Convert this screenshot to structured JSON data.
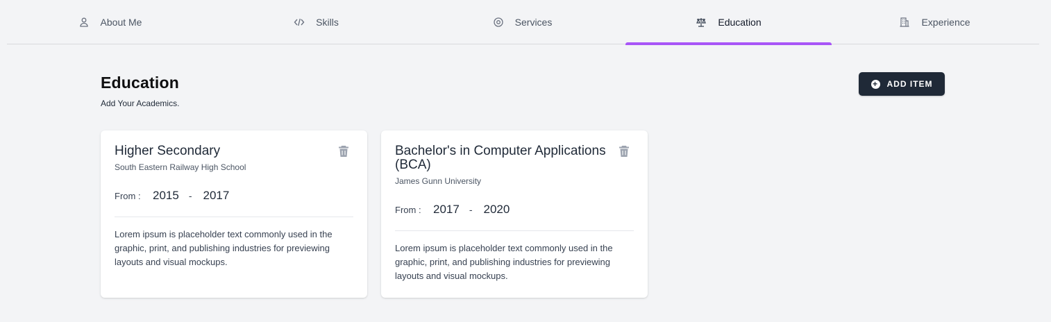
{
  "tabs": [
    {
      "label": "About Me",
      "icon": "user-icon"
    },
    {
      "label": "Skills",
      "icon": "code-icon"
    },
    {
      "label": "Services",
      "icon": "target-icon"
    },
    {
      "label": "Education",
      "icon": "scale-icon",
      "active": true
    },
    {
      "label": "Experience",
      "icon": "building-icon"
    }
  ],
  "accent_color": "#a855f7",
  "header": {
    "title": "Education",
    "subtitle": "Add Your Academics.",
    "add_button_label": "ADD ITEM"
  },
  "cards": [
    {
      "title": "Higher Secondary",
      "school": "South Eastern Railway High School",
      "from_label": "From :",
      "start_year": "2015",
      "separator": "-",
      "end_year": "2017",
      "description": "Lorem ipsum is placeholder text commonly used in the graphic, print, and publishing industries for previewing layouts and visual mockups."
    },
    {
      "title": "Bachelor's in Computer Applications (BCA)",
      "school": "James Gunn University",
      "from_label": "From :",
      "start_year": "2017",
      "separator": "-",
      "end_year": "2020",
      "description": "Lorem ipsum is placeholder text commonly used in the graphic, print, and publishing industries for previewing layouts and visual mockups."
    }
  ]
}
